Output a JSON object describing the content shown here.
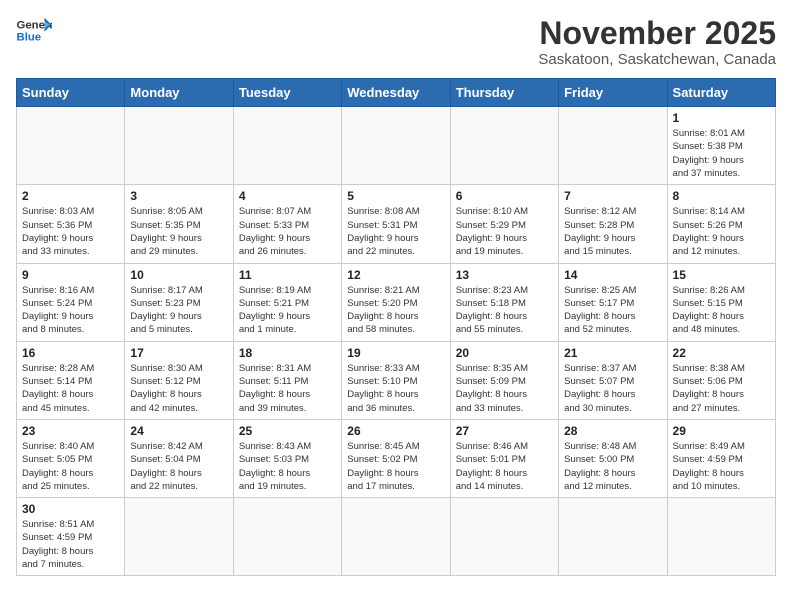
{
  "header": {
    "logo_general": "General",
    "logo_blue": "Blue",
    "month_title": "November 2025",
    "location": "Saskatoon, Saskatchewan, Canada"
  },
  "weekdays": [
    "Sunday",
    "Monday",
    "Tuesday",
    "Wednesday",
    "Thursday",
    "Friday",
    "Saturday"
  ],
  "weeks": [
    [
      {
        "day": "",
        "info": ""
      },
      {
        "day": "",
        "info": ""
      },
      {
        "day": "",
        "info": ""
      },
      {
        "day": "",
        "info": ""
      },
      {
        "day": "",
        "info": ""
      },
      {
        "day": "",
        "info": ""
      },
      {
        "day": "1",
        "info": "Sunrise: 8:01 AM\nSunset: 5:38 PM\nDaylight: 9 hours\nand 37 minutes."
      }
    ],
    [
      {
        "day": "2",
        "info": "Sunrise: 8:03 AM\nSunset: 5:36 PM\nDaylight: 9 hours\nand 33 minutes."
      },
      {
        "day": "3",
        "info": "Sunrise: 8:05 AM\nSunset: 5:35 PM\nDaylight: 9 hours\nand 29 minutes."
      },
      {
        "day": "4",
        "info": "Sunrise: 8:07 AM\nSunset: 5:33 PM\nDaylight: 9 hours\nand 26 minutes."
      },
      {
        "day": "5",
        "info": "Sunrise: 8:08 AM\nSunset: 5:31 PM\nDaylight: 9 hours\nand 22 minutes."
      },
      {
        "day": "6",
        "info": "Sunrise: 8:10 AM\nSunset: 5:29 PM\nDaylight: 9 hours\nand 19 minutes."
      },
      {
        "day": "7",
        "info": "Sunrise: 8:12 AM\nSunset: 5:28 PM\nDaylight: 9 hours\nand 15 minutes."
      },
      {
        "day": "8",
        "info": "Sunrise: 8:14 AM\nSunset: 5:26 PM\nDaylight: 9 hours\nand 12 minutes."
      }
    ],
    [
      {
        "day": "9",
        "info": "Sunrise: 8:16 AM\nSunset: 5:24 PM\nDaylight: 9 hours\nand 8 minutes."
      },
      {
        "day": "10",
        "info": "Sunrise: 8:17 AM\nSunset: 5:23 PM\nDaylight: 9 hours\nand 5 minutes."
      },
      {
        "day": "11",
        "info": "Sunrise: 8:19 AM\nSunset: 5:21 PM\nDaylight: 9 hours\nand 1 minute."
      },
      {
        "day": "12",
        "info": "Sunrise: 8:21 AM\nSunset: 5:20 PM\nDaylight: 8 hours\nand 58 minutes."
      },
      {
        "day": "13",
        "info": "Sunrise: 8:23 AM\nSunset: 5:18 PM\nDaylight: 8 hours\nand 55 minutes."
      },
      {
        "day": "14",
        "info": "Sunrise: 8:25 AM\nSunset: 5:17 PM\nDaylight: 8 hours\nand 52 minutes."
      },
      {
        "day": "15",
        "info": "Sunrise: 8:26 AM\nSunset: 5:15 PM\nDaylight: 8 hours\nand 48 minutes."
      }
    ],
    [
      {
        "day": "16",
        "info": "Sunrise: 8:28 AM\nSunset: 5:14 PM\nDaylight: 8 hours\nand 45 minutes."
      },
      {
        "day": "17",
        "info": "Sunrise: 8:30 AM\nSunset: 5:12 PM\nDaylight: 8 hours\nand 42 minutes."
      },
      {
        "day": "18",
        "info": "Sunrise: 8:31 AM\nSunset: 5:11 PM\nDaylight: 8 hours\nand 39 minutes."
      },
      {
        "day": "19",
        "info": "Sunrise: 8:33 AM\nSunset: 5:10 PM\nDaylight: 8 hours\nand 36 minutes."
      },
      {
        "day": "20",
        "info": "Sunrise: 8:35 AM\nSunset: 5:09 PM\nDaylight: 8 hours\nand 33 minutes."
      },
      {
        "day": "21",
        "info": "Sunrise: 8:37 AM\nSunset: 5:07 PM\nDaylight: 8 hours\nand 30 minutes."
      },
      {
        "day": "22",
        "info": "Sunrise: 8:38 AM\nSunset: 5:06 PM\nDaylight: 8 hours\nand 27 minutes."
      }
    ],
    [
      {
        "day": "23",
        "info": "Sunrise: 8:40 AM\nSunset: 5:05 PM\nDaylight: 8 hours\nand 25 minutes."
      },
      {
        "day": "24",
        "info": "Sunrise: 8:42 AM\nSunset: 5:04 PM\nDaylight: 8 hours\nand 22 minutes."
      },
      {
        "day": "25",
        "info": "Sunrise: 8:43 AM\nSunset: 5:03 PM\nDaylight: 8 hours\nand 19 minutes."
      },
      {
        "day": "26",
        "info": "Sunrise: 8:45 AM\nSunset: 5:02 PM\nDaylight: 8 hours\nand 17 minutes."
      },
      {
        "day": "27",
        "info": "Sunrise: 8:46 AM\nSunset: 5:01 PM\nDaylight: 8 hours\nand 14 minutes."
      },
      {
        "day": "28",
        "info": "Sunrise: 8:48 AM\nSunset: 5:00 PM\nDaylight: 8 hours\nand 12 minutes."
      },
      {
        "day": "29",
        "info": "Sunrise: 8:49 AM\nSunset: 4:59 PM\nDaylight: 8 hours\nand 10 minutes."
      }
    ],
    [
      {
        "day": "30",
        "info": "Sunrise: 8:51 AM\nSunset: 4:59 PM\nDaylight: 8 hours\nand 7 minutes."
      },
      {
        "day": "",
        "info": ""
      },
      {
        "day": "",
        "info": ""
      },
      {
        "day": "",
        "info": ""
      },
      {
        "day": "",
        "info": ""
      },
      {
        "day": "",
        "info": ""
      },
      {
        "day": "",
        "info": ""
      }
    ]
  ]
}
